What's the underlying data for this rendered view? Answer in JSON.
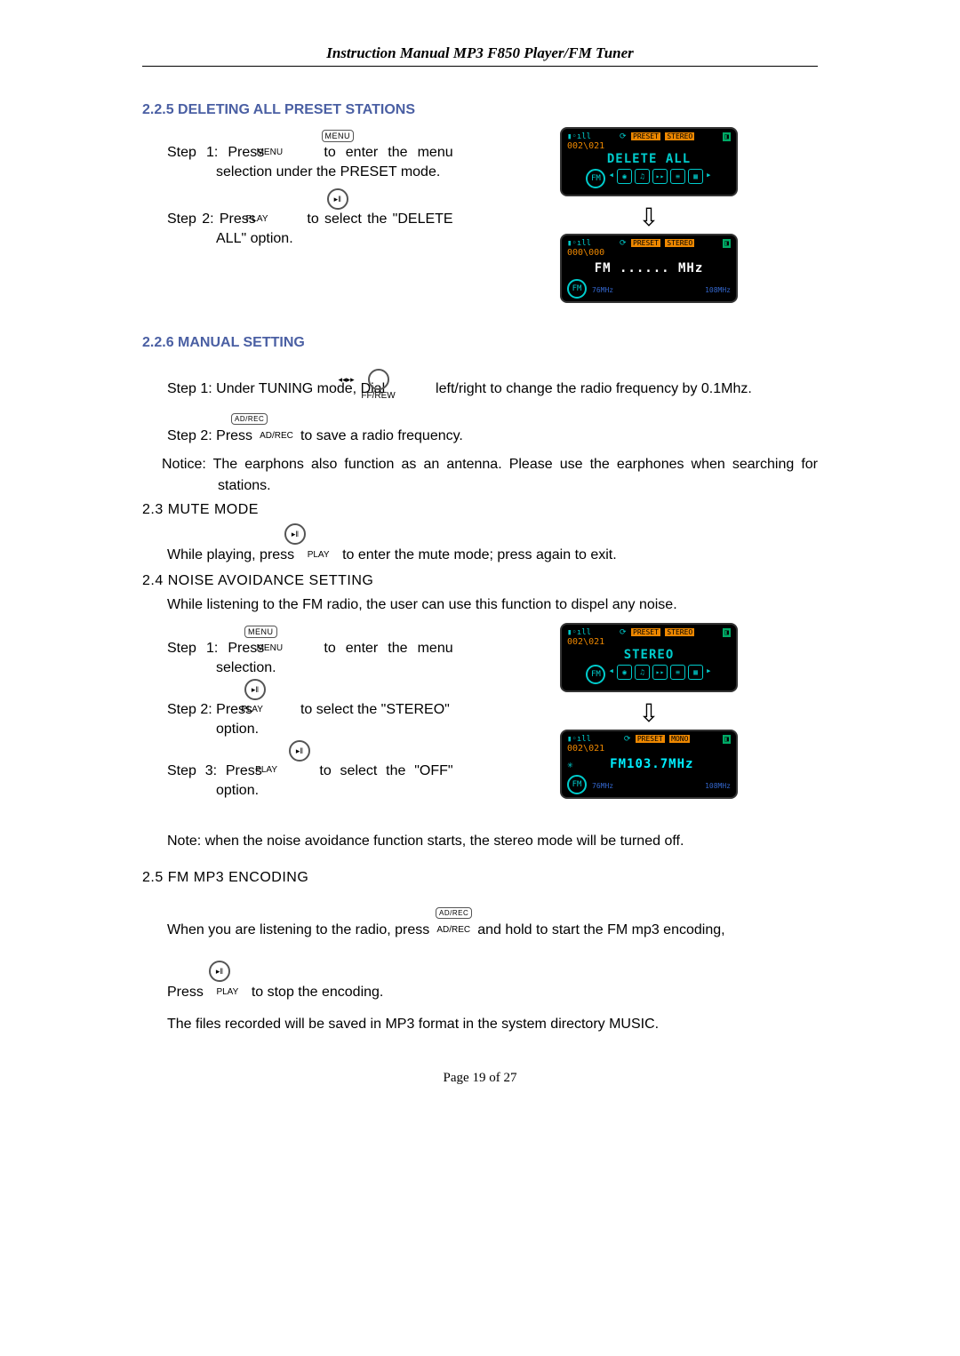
{
  "header": "Instruction Manual MP3 F850 Player/FM Tuner",
  "s225": {
    "title": "2.2.5 DELETING ALL PRESET STATIONS",
    "step1_a": "Step 1: Press",
    "step1_b": "to enter the menu selection under the PRESET mode.",
    "step2_a": "Step 2: Press",
    "step2_b": "to select the \"DELETE ALL\" option.",
    "screen1": "DELETE ALL",
    "screen2": "FM ...... MHz",
    "range_lo": "76MHz",
    "range_hi": "108MHz",
    "topclock": "002\\021",
    "topclock2": "000\\000"
  },
  "s226": {
    "title": "2.2.6 MANUAL SETTING",
    "step1_a": "Step 1: Under TUNING mode, Dial",
    "step1_b": "left/right to change the radio frequency by 0.1Mhz.",
    "step2_a": "Step 2: Press",
    "step2_b": "to save a radio frequency.",
    "notice": "Notice: The earphons also function as an antenna. Please use the earphones when searching for stations."
  },
  "s23": {
    "title": "2.3 MUTE MODE",
    "text_a": "While playing, press",
    "text_b": "to enter the mute mode; press again to exit."
  },
  "s24": {
    "title": "2.4 NOISE AVOIDANCE SETTING",
    "intro": "While listening to the FM radio, the user can use this function to dispel any noise.",
    "step1_a": "Step 1: Press",
    "step1_b": "to enter the menu selection.",
    "step2_a": "Step 2: Press",
    "step2_b": "to select the \"STEREO\" option.",
    "step3_a": "Step 3: Press",
    "step3_b": "to select the \"OFF\" option.",
    "screen1": "STEREO",
    "screen2": "FM103.7MHz",
    "topclock": "002\\021",
    "note": "Note: when the noise avoidance function starts, the stereo mode will be turned off."
  },
  "s25": {
    "title": "2.5 FM MP3 ENCODING",
    "line1_a": "When you are listening to the radio, press",
    "line1_b": "and hold to start the FM mp3 encoding,",
    "line2_a": "Press",
    "line2_b": "to stop the encoding.",
    "footer_line": "The files recorded will be saved in MP3 format in the system directory MUSIC."
  },
  "buttons": {
    "menu": "MENU",
    "play": "PLAY",
    "ffrew": "FF/REW",
    "adrec": "AD/REC"
  },
  "badges": {
    "preset": "PRESET",
    "stereo": "STEREO",
    "mono": "MONO"
  },
  "footer": "Page  19  of  27"
}
